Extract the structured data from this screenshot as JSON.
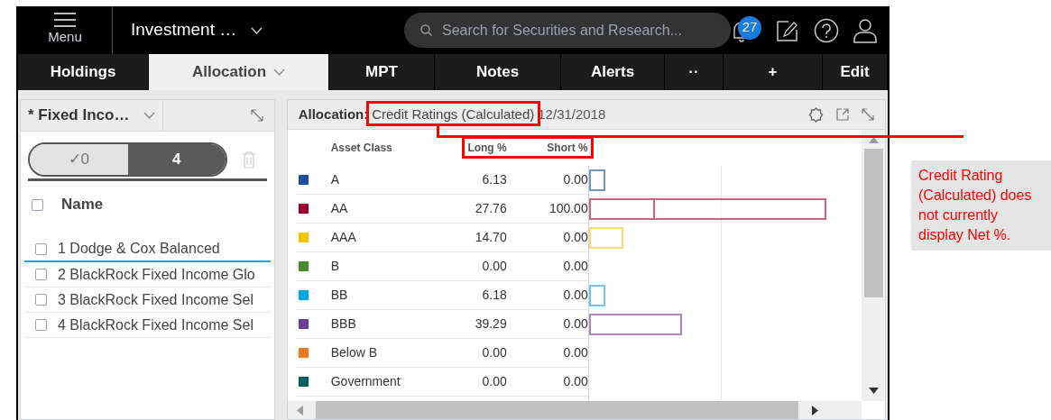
{
  "top_bar": {
    "menu_label": "Menu",
    "workspace_title": "Investment …",
    "search": {
      "placeholder": "Search for Securities and Research..."
    },
    "notification_count": "27"
  },
  "tabs": [
    {
      "label": "Holdings",
      "selected": false,
      "kind": "text"
    },
    {
      "label": "Allocation",
      "selected": true,
      "kind": "dropdown"
    },
    {
      "label": "MPT",
      "selected": false,
      "kind": "text"
    },
    {
      "label": "Notes",
      "selected": false,
      "kind": "text"
    },
    {
      "label": "Alerts",
      "selected": false,
      "kind": "text"
    },
    {
      "label": "··",
      "selected": false,
      "kind": "text"
    },
    {
      "label": "+",
      "selected": false,
      "kind": "text"
    },
    {
      "label": "Edit",
      "selected": false,
      "kind": "bold"
    }
  ],
  "list_panel": {
    "title": "* Fixed Inco…",
    "toggle": [
      {
        "label": "✓0",
        "selected": false
      },
      {
        "label": "4",
        "selected": true
      }
    ],
    "column": "Name",
    "select_all_checked": false,
    "rows": [
      {
        "label": "1 Dodge & Cox Balanced",
        "checked": false,
        "selected": true
      },
      {
        "label": "2 BlackRock Fixed Income Glo",
        "checked": false,
        "selected": false
      },
      {
        "label": "3 BlackRock Fixed Income Sel",
        "checked": false,
        "selected": false
      },
      {
        "label": "4 BlackRock Fixed Income Sel",
        "checked": false,
        "selected": false
      }
    ]
  },
  "allocation_panel": {
    "label": "Allocation:",
    "view": "Credit Ratings (Calculated)",
    "date": "12/31/2018",
    "columns": [
      "Asset Class",
      "Long %",
      "Short %"
    ],
    "rows": [
      {
        "name": "A",
        "long": "6.13",
        "short": "0.00",
        "color": "#1f4e9c"
      },
      {
        "name": "AA",
        "long": "27.76",
        "short": "100.00",
        "color": "#a0002a"
      },
      {
        "name": "AAA",
        "long": "14.70",
        "short": "0.00",
        "color": "#f5c400"
      },
      {
        "name": "B",
        "long": "0.00",
        "short": "0.00",
        "color": "#4a8a2a"
      },
      {
        "name": "BB",
        "long": "6.18",
        "short": "0.00",
        "color": "#00a8e0"
      },
      {
        "name": "BBB",
        "long": "39.29",
        "short": "0.00",
        "color": "#6a3d9a"
      },
      {
        "name": "Below B",
        "long": "0.00",
        "short": "0.00",
        "color": "#f07820"
      },
      {
        "name": "Government",
        "long": "0.00",
        "short": "0.00",
        "color": "#006060"
      }
    ]
  },
  "callout": {
    "text": "Credit Rating (Calculated) does not currently display Net %."
  }
}
